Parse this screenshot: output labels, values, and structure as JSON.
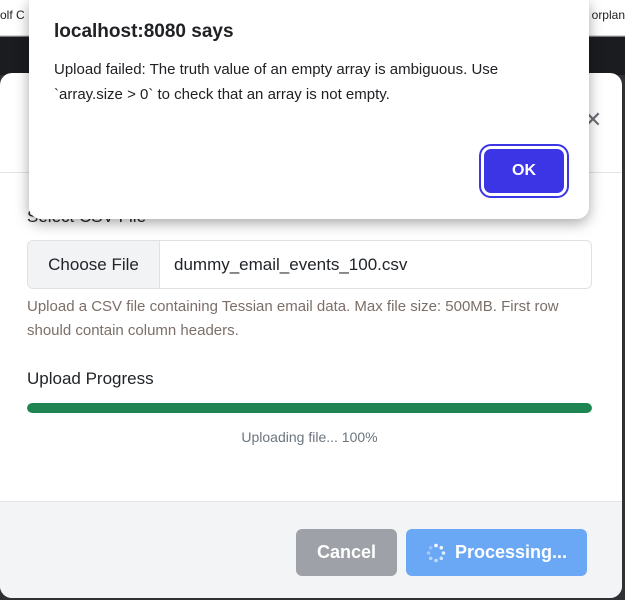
{
  "browser": {
    "bookmark_left": "olf C",
    "bookmark_right": "orplan"
  },
  "modal": {
    "close_icon": "close-icon",
    "field_label": "Select CSV File",
    "file_input": {
      "button_label": "Choose File",
      "file_name": "dummy_email_events_100.csv"
    },
    "help_text": "Upload a CSV file containing Tessian email data. Max file size: 500MB. First row should contain column headers.",
    "progress": {
      "label": "Upload Progress",
      "value": 1.0,
      "status": "Uploading file... 100%",
      "color": "#1e8552"
    },
    "footer": {
      "cancel_label": "Cancel",
      "processing_label": "Processing...",
      "spinner_icon": "spinner-icon"
    }
  },
  "alert": {
    "title": "localhost:8080 says",
    "message": "Upload failed: The truth value of an empty array is ambiguous. Use `array.size > 0` to check that an array is not empty.",
    "ok_label": "OK",
    "accent": "#3b35e6"
  }
}
